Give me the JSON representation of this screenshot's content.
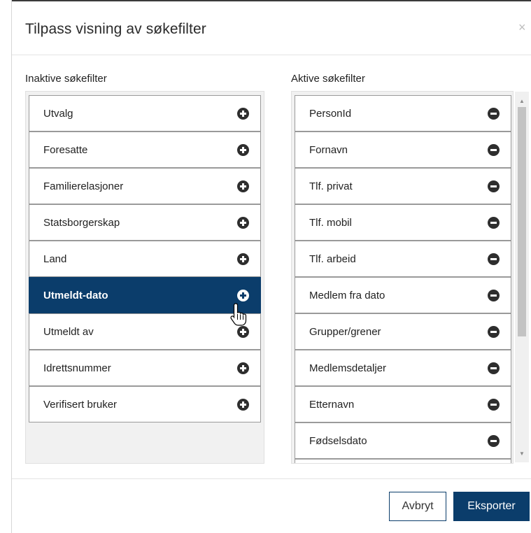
{
  "dialog": {
    "title": "Tilpass visning av søkefilter",
    "close_label": "×"
  },
  "inactive": {
    "label": "Inaktive søkefilter",
    "items": [
      {
        "label": "Utvalg"
      },
      {
        "label": "Foresatte"
      },
      {
        "label": "Familierelasjoner"
      },
      {
        "label": "Statsborgerskap"
      },
      {
        "label": "Land"
      },
      {
        "label": "Utmeldt-dato",
        "selected": true
      },
      {
        "label": "Utmeldt av"
      },
      {
        "label": "Idrettsnummer"
      },
      {
        "label": "Verifisert bruker"
      }
    ]
  },
  "active": {
    "label": "Aktive søkefilter",
    "items": [
      {
        "label": "PersonId"
      },
      {
        "label": "Fornavn"
      },
      {
        "label": "Tlf. privat"
      },
      {
        "label": "Tlf. mobil"
      },
      {
        "label": "Tlf. arbeid"
      },
      {
        "label": "Medlem fra dato"
      },
      {
        "label": "Grupper/grener"
      },
      {
        "label": "Medlemsdetaljer"
      },
      {
        "label": "Etternavn"
      },
      {
        "label": "Fødselsdato"
      },
      {
        "label": ""
      }
    ]
  },
  "footer": {
    "cancel_label": "Avbryt",
    "export_label": "Eksporter"
  },
  "colors": {
    "primary": "#0b3d6b",
    "icon": "#2e2e2e"
  }
}
